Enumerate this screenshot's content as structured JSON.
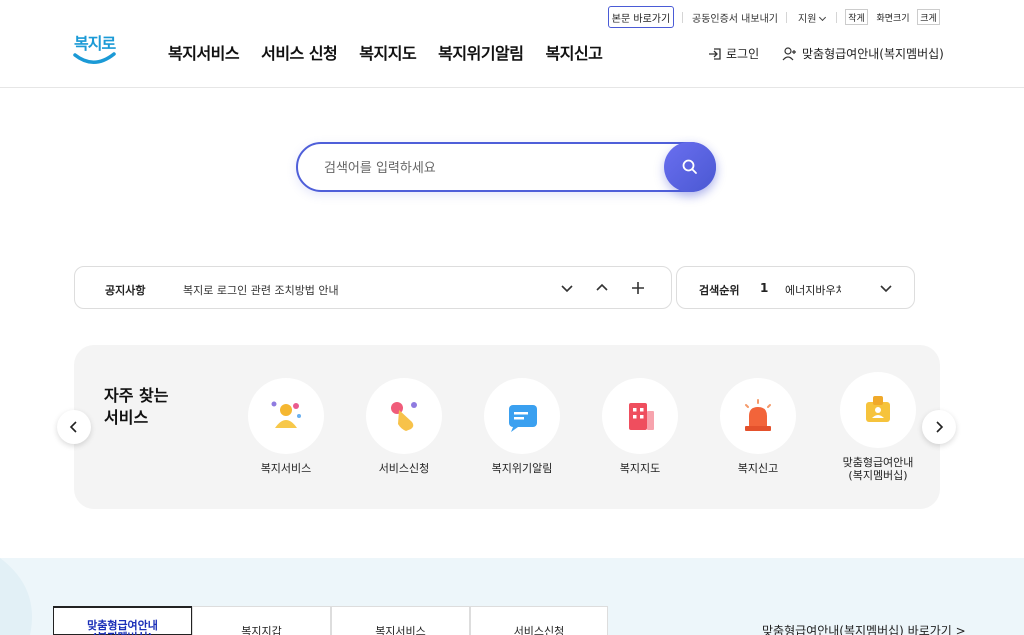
{
  "util": {
    "skip_label": "본문 바로가기",
    "cert_label": "공동인증서 내보내기",
    "support_label": "지원",
    "font_small": "작게",
    "font_size_label": "화면크기",
    "font_large": "크게"
  },
  "header": {
    "logo_text": "복지로",
    "nav": [
      "복지서비스",
      "서비스 신청",
      "복지지도",
      "복지위기알림",
      "복지신고"
    ],
    "login_label": "로그인",
    "member_label": "맞춤형급여안내(복지멤버십)"
  },
  "search": {
    "placeholder": "검색어를 입력하세요"
  },
  "notice": {
    "title": "공지사항",
    "text": "복지로 로그인 관련 조치방법 안내"
  },
  "rank": {
    "title": "검색순위",
    "number": "1",
    "word": "에너지바우처"
  },
  "frequent": {
    "title_line1": "자주 찾는",
    "title_line2": "서비스",
    "items": [
      {
        "label": "복지서비스",
        "icon": "people-icon"
      },
      {
        "label": "서비스신청",
        "icon": "tap-hand-icon"
      },
      {
        "label": "복지위기알림",
        "icon": "message-icon"
      },
      {
        "label": "복지지도",
        "icon": "building-icon"
      },
      {
        "label": "복지신고",
        "icon": "siren-icon"
      },
      {
        "label": "맞춤형급여안내\n(복지멤버십)",
        "icon": "membership-badge-icon"
      }
    ]
  },
  "bottom": {
    "tabs": [
      "맞춤형급여안내\n(복지멤버십)",
      "복지지갑",
      "복지서비스",
      "서비스신청"
    ],
    "shortcut_label": "맞춤형급여안내(복지멤버십) 바로가기"
  },
  "colors": {
    "accent": "#4f5fd9",
    "logo": "#1b9ad6",
    "panel": "#f4f4f4",
    "bottom_bg": "#edf6fa"
  }
}
